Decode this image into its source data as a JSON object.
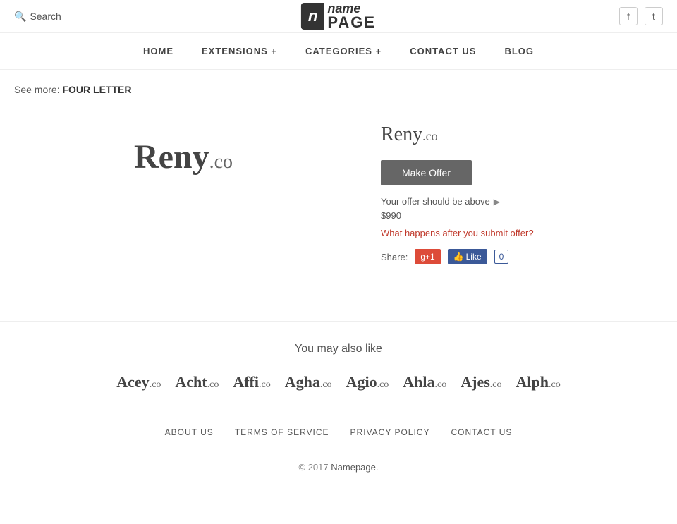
{
  "header": {
    "search_label": "Search",
    "logo_icon": "n",
    "logo_name": "name",
    "logo_page": "PAGE",
    "social": {
      "facebook_label": "f",
      "twitter_label": "t"
    }
  },
  "nav": {
    "items": [
      {
        "label": "HOME",
        "key": "home"
      },
      {
        "label": "EXTENSIONS +",
        "key": "extensions"
      },
      {
        "label": "CATEGORIES +",
        "key": "categories"
      },
      {
        "label": "CONTACT US",
        "key": "contact"
      },
      {
        "label": "BLOG",
        "key": "blog"
      }
    ]
  },
  "see_more": {
    "prefix": "See more:",
    "link": "FOUR LETTER"
  },
  "domain": {
    "name": "Reny",
    "tld": ".co",
    "full": "Reny.co",
    "make_offer_label": "Make Offer",
    "offer_hint": "Your offer should be above",
    "offer_amount": "$990",
    "submit_link": "What happens after you submit offer?",
    "share_label": "Share:",
    "gplus_label": "g+1",
    "fb_like_label": "Like",
    "fb_count": "0"
  },
  "also_like": {
    "title": "You may also like",
    "domains": [
      {
        "name": "Acey",
        "tld": ".co"
      },
      {
        "name": "Acht",
        "tld": ".co"
      },
      {
        "name": "Affi",
        "tld": ".co"
      },
      {
        "name": "Agha",
        "tld": ".co"
      },
      {
        "name": "Agio",
        "tld": ".co"
      },
      {
        "name": "Ahla",
        "tld": ".co"
      },
      {
        "name": "Ajes",
        "tld": ".co"
      },
      {
        "name": "Alph",
        "tld": ".co"
      }
    ]
  },
  "footer": {
    "links": [
      {
        "label": "ABOUT US",
        "key": "about"
      },
      {
        "label": "TERMS OF SERVICE",
        "key": "terms"
      },
      {
        "label": "PRIVACY POLICY",
        "key": "privacy"
      },
      {
        "label": "CONTACT US",
        "key": "contact"
      }
    ],
    "copyright_prefix": "© 2017",
    "copyright_brand": "Namepage.",
    "copyright_suffix": ""
  }
}
